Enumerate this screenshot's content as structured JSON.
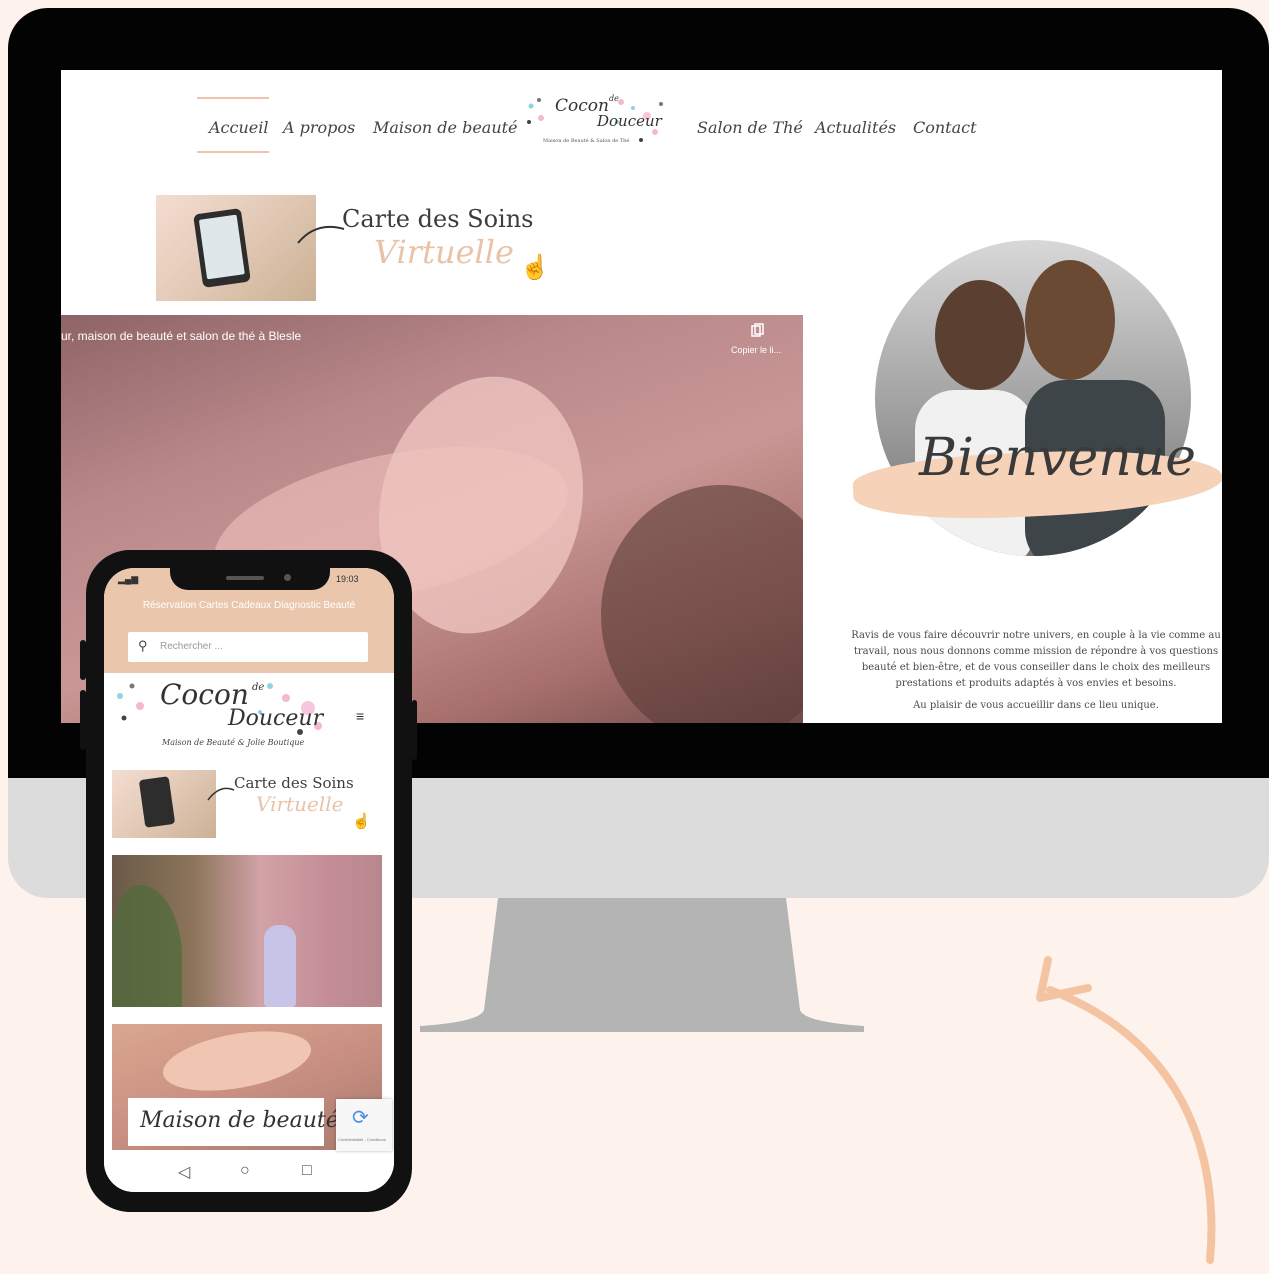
{
  "desktop": {
    "nav": {
      "items": [
        "Accueil",
        "A propos",
        "Maison de beauté",
        "Salon de Thé",
        "Actualités",
        "Contact"
      ],
      "active": "Accueil"
    },
    "logo": {
      "line1": "Cocon",
      "small": "de",
      "line2": "Douceur",
      "tagline": "Maison de Beauté & Salon de Thé"
    },
    "banner": {
      "title": "Carte des Soins",
      "subtitle": "Virtuelle"
    },
    "video": {
      "title": "ur, maison de beauté et salon de thé à Blesle",
      "copy_label": "Copier le li..."
    },
    "welcome": {
      "title": "Bienvenue",
      "paragraph": "Ravis de vous faire découvrir notre univers, en couple à la vie comme au travail, nous nous donnons comme mission de répondre à vos questions beauté et bien-être, et de vous conseiller dans le choix des meilleurs prestations et produits adaptés à vos envies et besoins.",
      "closing": "Au plaisir de vous accueillir dans ce lieu unique."
    }
  },
  "mobile": {
    "status": {
      "time": "19:03",
      "battery": "%"
    },
    "top_links": "Réservation  Cartes Cadeaux  Diagnostic Beauté",
    "search": {
      "placeholder": "Rechercher ..."
    },
    "logo": {
      "line1": "Cocon",
      "small": "de",
      "line2": "Douceur",
      "tagline": "Maison de Beauté & Jolie Boutique"
    },
    "banner": {
      "title": "Carte des Soins",
      "subtitle": "Virtuelle"
    },
    "section_label": "Maison de beauté",
    "recaptcha_text": "Confidentialité - Conditions"
  },
  "colors": {
    "accent": "#f0c4ab",
    "background": "#fdf3ec",
    "peach_brush": "#f6d2b9",
    "arrow": "#f4c3a2"
  }
}
